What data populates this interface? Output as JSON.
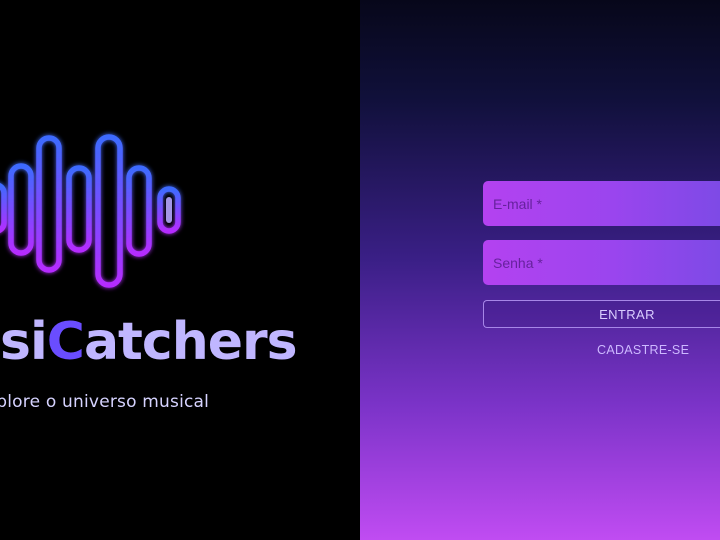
{
  "brand": {
    "title_part1": "usi",
    "title_part2": "C",
    "title_part3": "atchers",
    "tagline": "xplore o universo musical",
    "logo_icon": "sound-wave-icon",
    "colors": {
      "title": "#c0b6ff",
      "title_accent": "#6a4dff",
      "wave_top": "#3d6bff",
      "wave_bottom": "#b52cff"
    }
  },
  "login_form": {
    "email_placeholder": "E-mail *",
    "password_placeholder": "Senha *",
    "submit_label": "ENTRAR",
    "signup_label": "CADASTRE-SE"
  },
  "colors": {
    "left_background": "#000000",
    "right_gradient_top": "#07071a",
    "right_gradient_bottom": "#c04cf2",
    "field_background": "#b442f0"
  }
}
